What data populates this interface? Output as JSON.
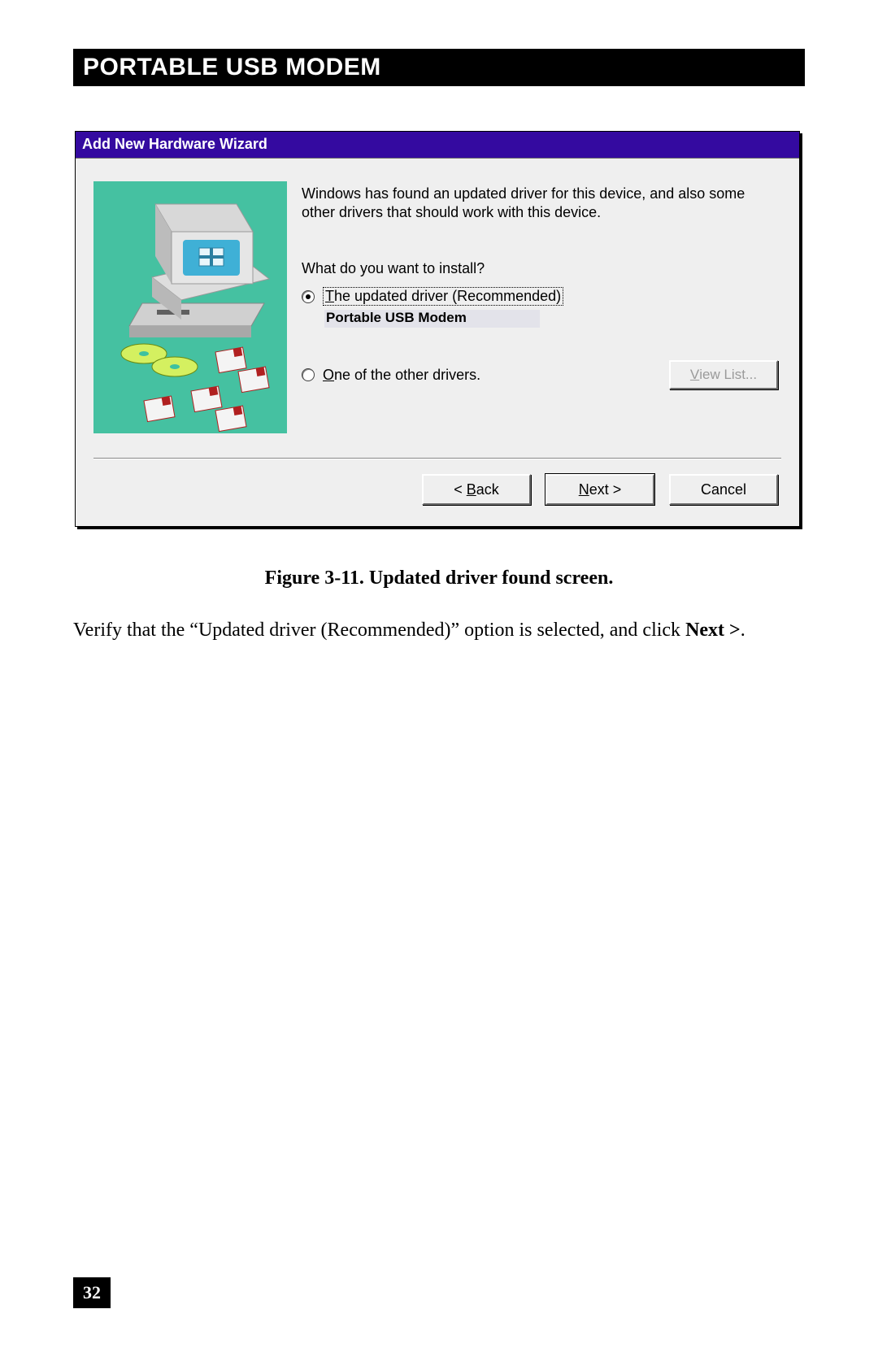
{
  "header": {
    "title": "PORTABLE USB MODEM"
  },
  "dialog": {
    "title": "Add New Hardware Wizard",
    "intro": "Windows has found an updated driver for this device, and also some other drivers that should work with this device.",
    "prompt": "What do you want to install?",
    "option1_label": "The updated driver (Recommended)",
    "option1_driver": "Portable USB Modem",
    "option2_label": "One of the other drivers.",
    "view_list": "View List...",
    "back": "< Back",
    "next": "Next >",
    "cancel": "Cancel"
  },
  "caption": "Figure 3-11. Updated driver found screen.",
  "body_text_pre": "Verify that the “Updated driver (Recommended)” option is selected, and click ",
  "body_text_bold": "Next >",
  "body_text_post": ".",
  "page_number": "32"
}
